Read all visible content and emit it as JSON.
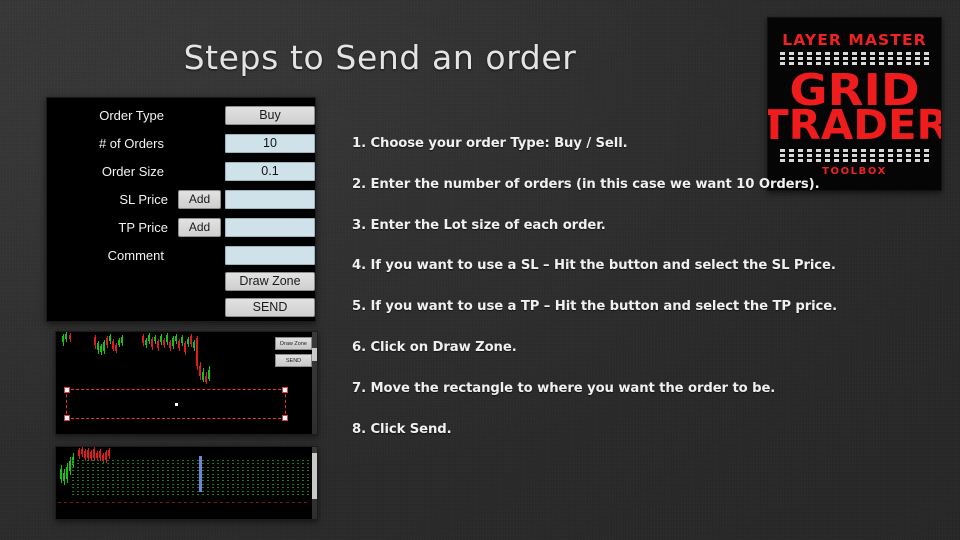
{
  "slide": {
    "title": "Steps to Send an order",
    "background_color": "#2c2c2c"
  },
  "logo": {
    "top_text": "LAYER MASTER",
    "main_line1": "GRID",
    "main_line2": "TRADER",
    "bottom_text": "TOOLBOX",
    "accent_color": "#ee1c1c",
    "background_color": "#050505"
  },
  "order_panel": {
    "name": "order-entry-panel",
    "rows": [
      {
        "label": "Order Type",
        "control": "button",
        "value": "Buy",
        "has_add": false
      },
      {
        "label": "# of Orders",
        "control": "field",
        "value": "10",
        "has_add": false
      },
      {
        "label": "Order Size",
        "control": "field",
        "value": "0.1",
        "has_add": false
      },
      {
        "label": "SL Price",
        "control": "field",
        "value": "",
        "has_add": true,
        "add_label": "Add"
      },
      {
        "label": "TP Price",
        "control": "field",
        "value": "",
        "has_add": true,
        "add_label": "Add"
      },
      {
        "label": "Comment",
        "control": "field",
        "value": "",
        "has_add": false
      }
    ],
    "draw_zone_label": "Draw Zone",
    "send_label": "SEND",
    "field_color": "#cfe2ea",
    "button_color": "#d4d4d4"
  },
  "chart_zone": {
    "name": "chart-with-draw-zone",
    "draw_zone_label": "Draw Zone",
    "send_label": "SEND"
  },
  "chart_grid": {
    "name": "chart-with-pending-grid"
  },
  "steps": [
    "1. Choose your order Type:   Buy / Sell.",
    "2. Enter the number of orders (in this case we want 10 Orders).",
    "3. Enter the Lot size of each order.",
    "4. If you want to use a SL – Hit the button and select the SL Price.",
    "5. If you want to use a TP – Hit the button and select the TP price.",
    "6. Click on Draw Zone.",
    "7. Move the rectangle to where you want the order to be.",
    "8. Click Send."
  ]
}
